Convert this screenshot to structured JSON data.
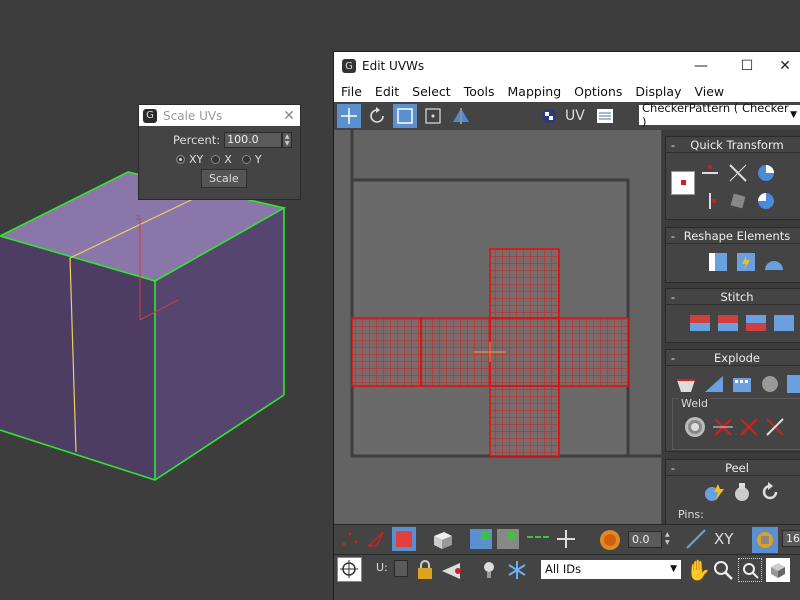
{
  "scale_dialog": {
    "title": "Scale UVs",
    "close_glyph": "✕",
    "percent_label": "Percent:",
    "percent_value": "100.0",
    "axis_options": [
      {
        "label": "XY",
        "selected": true
      },
      {
        "label": "X",
        "selected": false
      },
      {
        "label": "Y",
        "selected": false
      }
    ],
    "scale_button": "Scale"
  },
  "edit_uvws": {
    "title": "Edit UVWs",
    "window_controls": {
      "minimize": "—",
      "maximize": "☐",
      "close": "✕"
    },
    "menu": [
      "File",
      "Edit",
      "Select",
      "Tools",
      "Mapping",
      "Options",
      "Display",
      "View"
    ],
    "toolbar": {
      "uv_label": "UV",
      "map_select": "CheckerPattern  ( Checker )"
    },
    "panels": {
      "quick_transform": "Quick Transform",
      "reshape_elements": "Reshape Elements",
      "stitch": "Stitch",
      "explode": "Explode",
      "weld": "Weld",
      "peel": "Peel",
      "pins": "Pins:"
    },
    "bottom": {
      "value_field": "0.0",
      "xy_label": "XY",
      "grid_value": "16",
      "u_label": "U:",
      "ids_select": "All IDs"
    }
  },
  "colors": {
    "viewport_bg": "#3d3d3d",
    "cube_top": "#8a76a8",
    "cube_side": "#54436b",
    "cube_edge": "#2ee82e",
    "seam": "#e6d060",
    "uv_border": "#e01010",
    "selection": "#5a8fd0"
  }
}
